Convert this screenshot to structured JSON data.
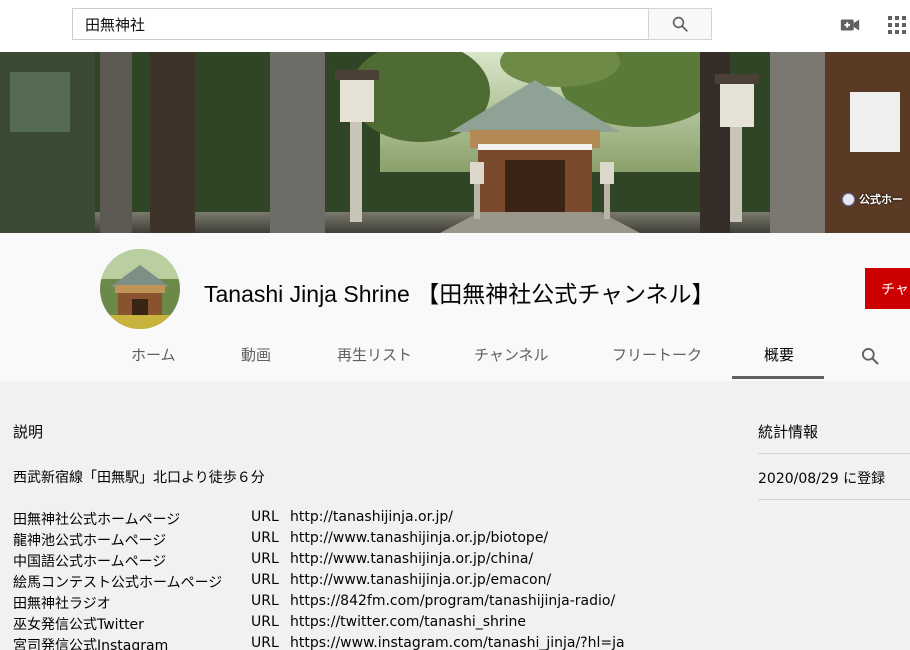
{
  "search": {
    "query": "田無神社"
  },
  "banner": {
    "link_label": "公式ホー"
  },
  "channel": {
    "title": "Tanashi Jinja Shrine 【田無神社公式チャンネル】",
    "subscribe_label": "チャ"
  },
  "tabs": [
    {
      "label": "ホーム"
    },
    {
      "label": "動画"
    },
    {
      "label": "再生リスト"
    },
    {
      "label": "チャンネル"
    },
    {
      "label": "フリートーク"
    },
    {
      "label": "概要"
    }
  ],
  "about": {
    "description_title": "説明",
    "access_line": "西武新宿線「田無駅」北口より徒歩６分",
    "url_label": "URL",
    "links": [
      {
        "name": "田無神社公式ホームページ",
        "url": "http://tanashijinja.or.jp/"
      },
      {
        "name": "龍神池公式ホームページ",
        "url": "http://www.tanashijinja.or.jp/biotope/"
      },
      {
        "name": "中国語公式ホームページ",
        "url": "http://www.tanashijinja.or.jp/china/"
      },
      {
        "name": "絵馬コンテスト公式ホームページ",
        "url": "http://www.tanashijinja.or.jp/emacon/"
      },
      {
        "name": "田無神社ラジオ",
        "url": "https://842fm.com/program/tanashijinja-radio/"
      },
      {
        "name": "巫女発信公式Twitter",
        "url": "https://twitter.com/tanashi_shrine"
      },
      {
        "name": "宮司発信公式Instagram",
        "url": "https://www.instagram.com/tanashi_jinja/?hl=ja"
      }
    ]
  },
  "stats": {
    "title": "統計情報",
    "joined": "2020/08/29 に登録"
  },
  "icons": {
    "search": "search-icon",
    "create_video": "video-camera-plus-icon",
    "apps": "apps-grid-icon",
    "tab_search": "search-icon"
  },
  "colors": {
    "subscribe": "#cc0000",
    "masthead": "#ffffff",
    "header_bg": "#f9f9f9",
    "page_bg": "#f1f1f1"
  }
}
